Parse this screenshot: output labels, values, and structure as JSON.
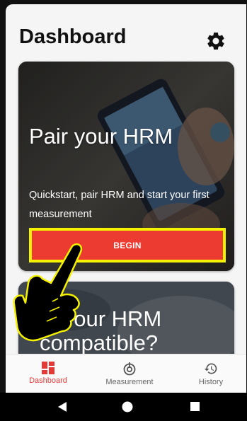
{
  "header": {
    "title": "Dashboard",
    "settings_icon": "gear-icon"
  },
  "card1": {
    "title": "Pair your HRM",
    "description": "Quickstart, pair HRM and start your first measurement",
    "button_label": "BEGIN"
  },
  "card2": {
    "title_partial": "Is your HRM compatible?"
  },
  "bottom_nav": {
    "items": [
      {
        "label": "Dashboard",
        "icon": "dashboard-icon",
        "active": true
      },
      {
        "label": "Measurement",
        "icon": "measurement-icon",
        "active": false
      },
      {
        "label": "History",
        "icon": "history-icon",
        "active": false
      }
    ]
  },
  "system_nav": {
    "back": "back-icon",
    "home": "home-icon",
    "recents": "recents-icon"
  },
  "colors": {
    "accent": "#e53935",
    "button": "#ec3b30",
    "highlight": "#f5f200",
    "background": "#f5f5f5"
  }
}
